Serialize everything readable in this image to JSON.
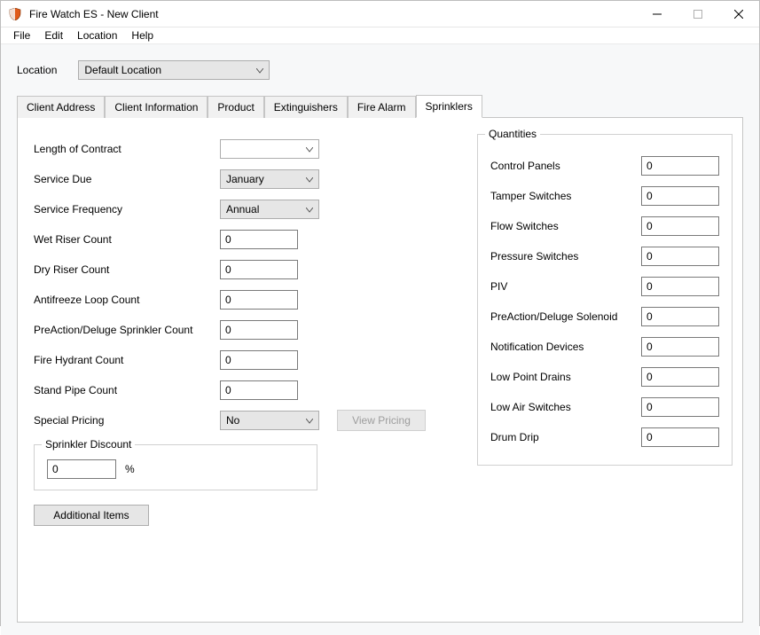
{
  "window": {
    "title": "Fire Watch ES - New Client"
  },
  "menubar": {
    "file": "File",
    "edit": "Edit",
    "location": "Location",
    "help": "Help"
  },
  "location": {
    "label": "Location",
    "value": "Default Location"
  },
  "tabs": {
    "client_address": "Client Address",
    "client_information": "Client Information",
    "product": "Product",
    "extinguishers": "Extinguishers",
    "fire_alarm": "Fire Alarm",
    "sprinklers": "Sprinklers"
  },
  "sprinklers": {
    "length_of_contract": {
      "label": "Length of Contract",
      "value": ""
    },
    "service_due": {
      "label": "Service Due",
      "value": "January"
    },
    "service_frequency": {
      "label": "Service Frequency",
      "value": "Annual"
    },
    "wet_riser": {
      "label": "Wet Riser Count",
      "value": "0"
    },
    "dry_riser": {
      "label": "Dry Riser Count",
      "value": "0"
    },
    "antifreeze": {
      "label": "Antifreeze Loop Count",
      "value": "0"
    },
    "preaction": {
      "label": "PreAction/Deluge Sprinkler Count",
      "value": "0"
    },
    "hydrant": {
      "label": "Fire Hydrant Count",
      "value": "0"
    },
    "standpipe": {
      "label": "Stand Pipe Count",
      "value": "0"
    },
    "special_pricing": {
      "label": "Special Pricing",
      "value": "No"
    },
    "view_pricing": "View Pricing",
    "discount_group": {
      "legend": "Sprinkler Discount",
      "value": "0",
      "unit": "%"
    },
    "additional_items": "Additional Items"
  },
  "quantities": {
    "legend": "Quantities",
    "control_panels": {
      "label": "Control Panels",
      "value": "0"
    },
    "tamper_switches": {
      "label": "Tamper Switches",
      "value": "0"
    },
    "flow_switches": {
      "label": "Flow Switches",
      "value": "0"
    },
    "pressure_switches": {
      "label": "Pressure Switches",
      "value": "0"
    },
    "piv": {
      "label": "PIV",
      "value": "0"
    },
    "preaction_solenoid": {
      "label": "PreAction/Deluge Solenoid",
      "value": "0"
    },
    "notification_devices": {
      "label": "Notification Devices",
      "value": "0"
    },
    "low_point_drains": {
      "label": "Low Point Drains",
      "value": "0"
    },
    "low_air_switches": {
      "label": "Low Air Switches",
      "value": "0"
    },
    "drum_drip": {
      "label": "Drum Drip",
      "value": "0"
    }
  }
}
